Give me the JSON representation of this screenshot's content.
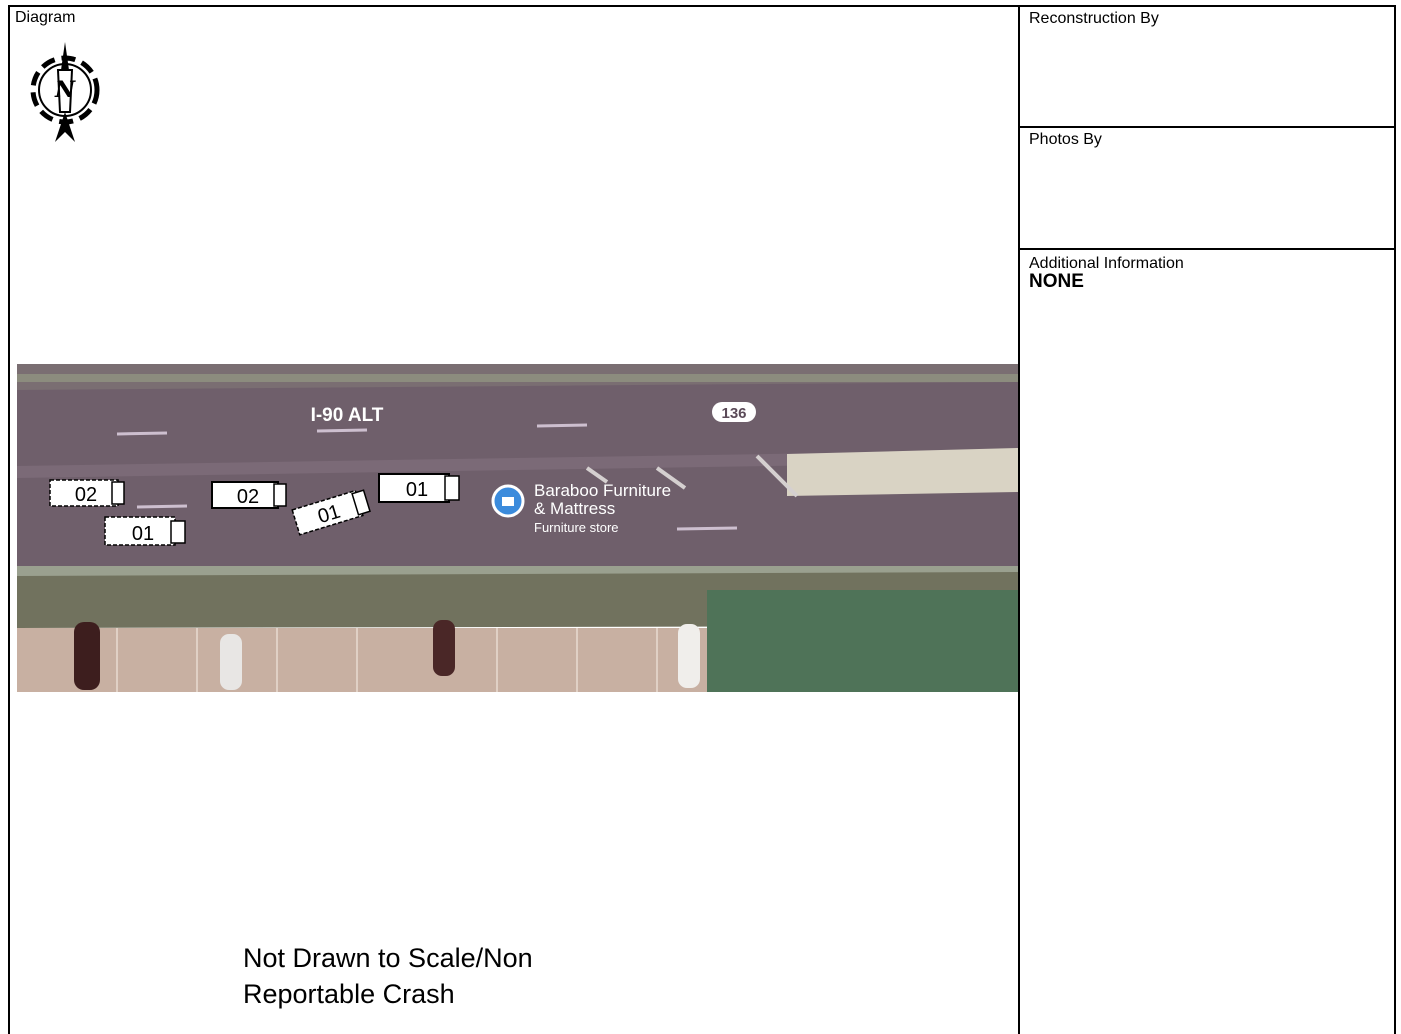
{
  "diagram": {
    "label": "Diagram",
    "compass_letter": "N",
    "map": {
      "road_name": "I-90 ALT",
      "route_shield": "136",
      "poi_name_line1": "Baraboo Furniture",
      "poi_name_line2": "& Mattress",
      "poi_category": "Furniture store"
    },
    "vehicles": [
      {
        "label": "02"
      },
      {
        "label": "01"
      },
      {
        "label": "02"
      },
      {
        "label": "01"
      },
      {
        "label": "01"
      }
    ],
    "note_line1": "Not Drawn to Scale/Non",
    "note_line2": "Reportable Crash"
  },
  "sidebar": {
    "reconstruction_label": "Reconstruction By",
    "photos_label": "Photos By",
    "additional_label": "Additional Information",
    "additional_value": "NONE"
  },
  "colors": {
    "road": "#6f5f6b",
    "grass": "#5f7a58",
    "lot": "#d9c3b4",
    "poi_pin": "#3b8bdc"
  }
}
